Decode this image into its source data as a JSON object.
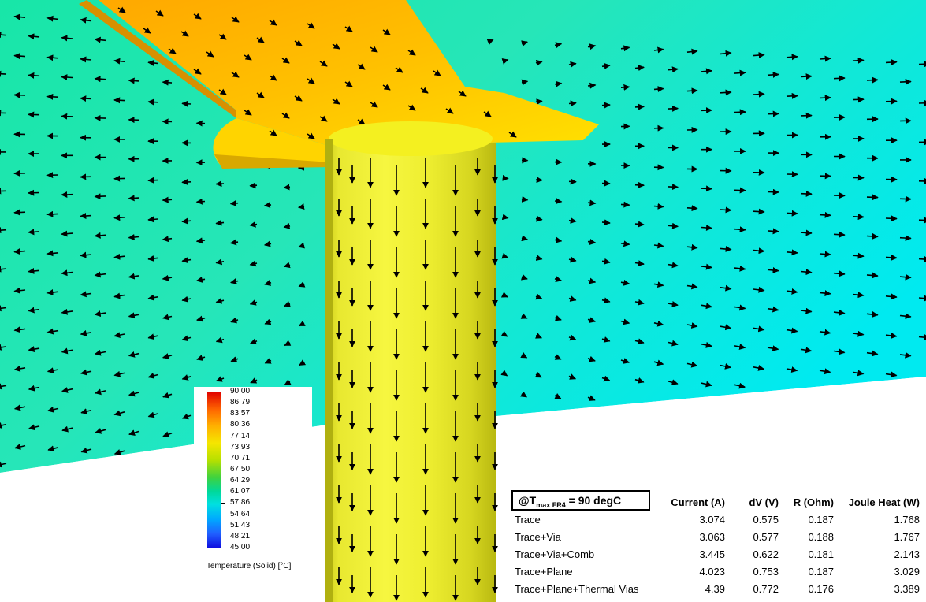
{
  "legend": {
    "ticks": [
      "90.00",
      "86.79",
      "83.57",
      "80.36",
      "77.14",
      "73.93",
      "70.71",
      "67.50",
      "64.29",
      "61.07",
      "57.86",
      "54.64",
      "51.43",
      "48.21",
      "45.00"
    ],
    "title": "Temperature (Solid) [°C]",
    "colors": {
      "max": "#e00000",
      "min": "#1010e0"
    }
  },
  "condition": {
    "prefix": "@T",
    "subscript": "max FR4",
    "suffix": " =  90 degC"
  },
  "table": {
    "headers": [
      "Current (A)",
      "dV (V)",
      "R (Ohm)",
      "Joule Heat (W)"
    ],
    "rows": [
      {
        "label": "Trace",
        "values": [
          "3.074",
          "0.575",
          "0.187",
          "1.768"
        ]
      },
      {
        "label": "Trace+Via",
        "values": [
          "3.063",
          "0.577",
          "0.188",
          "1.767"
        ]
      },
      {
        "label": "Trace+Via+Comb",
        "values": [
          "3.445",
          "0.622",
          "0.181",
          "2.143"
        ]
      },
      {
        "label": "Trace+Plane",
        "values": [
          "4.023",
          "0.753",
          "0.187",
          "3.029"
        ]
      },
      {
        "label": "Trace+Plane+Thermal Vias",
        "values": [
          "4.39",
          "0.772",
          "0.176",
          "3.389"
        ]
      }
    ]
  },
  "scene_colors": {
    "plane": "#22e6b6",
    "trace": "#ffb800",
    "via": "#ecec30"
  }
}
